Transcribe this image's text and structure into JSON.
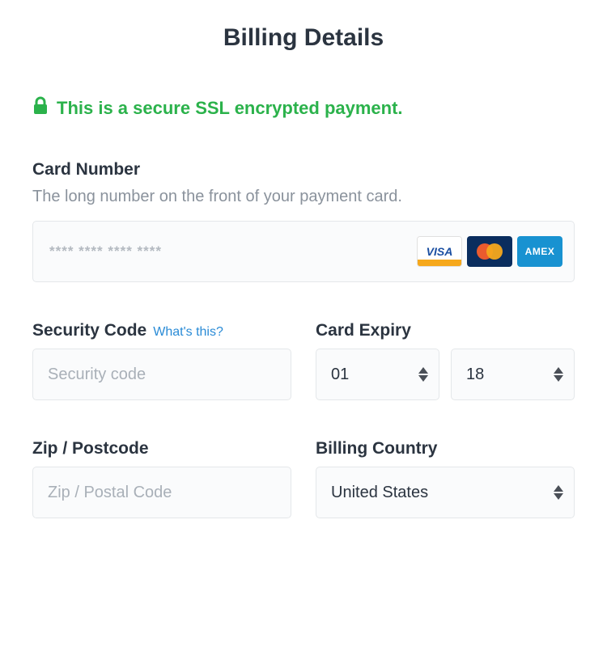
{
  "title": "Billing Details",
  "secure_message": "This is a secure SSL encrypted payment.",
  "card_number": {
    "label": "Card Number",
    "hint": "The long number on the front of your payment card.",
    "placeholder": "**** **** **** ****",
    "brands": {
      "visa": "VISA",
      "mastercard": "mastercard",
      "amex": "AMEX"
    }
  },
  "security_code": {
    "label": "Security Code",
    "help": "What's this?",
    "placeholder": "Security code"
  },
  "card_expiry": {
    "label": "Card Expiry",
    "month": "01",
    "year": "18"
  },
  "zip": {
    "label": "Zip / Postcode",
    "placeholder": "Zip / Postal Code"
  },
  "billing_country": {
    "label": "Billing Country",
    "value": "United States"
  },
  "colors": {
    "secure_green": "#2bb24b",
    "link_blue": "#2a8bd6"
  }
}
